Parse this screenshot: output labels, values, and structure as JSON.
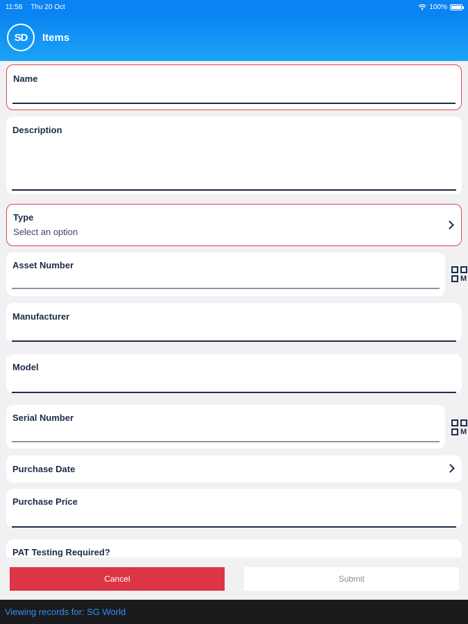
{
  "status_bar": {
    "time": "11:58",
    "date": "Thu 20 Oct",
    "battery": "100%",
    "wifi_icon": "wifi-icon",
    "battery_icon": "battery-icon"
  },
  "nav": {
    "logo": "SD",
    "title": "Items"
  },
  "fields": {
    "name": {
      "label": "Name"
    },
    "description": {
      "label": "Description"
    },
    "type": {
      "label": "Type",
      "placeholder": "Select an option"
    },
    "asset_number": {
      "label": "Asset Number"
    },
    "manufacturer": {
      "label": "Manufacturer"
    },
    "model": {
      "label": "Model"
    },
    "serial_number": {
      "label": "Serial Number"
    },
    "purchase_date": {
      "label": "Purchase Date"
    },
    "purchase_price": {
      "label": "Purchase Price"
    },
    "pat_testing": {
      "label": "PAT Testing Required?"
    }
  },
  "icons": {
    "scan": "qr-code-scan-icon",
    "chevron": "chevron-right-icon"
  },
  "buttons": {
    "cancel": "Cancel",
    "submit": "Submit"
  },
  "footer": {
    "text": "Viewing records for: SG World"
  },
  "colors": {
    "header": "#0a84f2",
    "error_border": "#e0434f",
    "cancel": "#dc3545",
    "footer_bg": "#1b1b1d",
    "footer_text": "#2f8ff0"
  }
}
